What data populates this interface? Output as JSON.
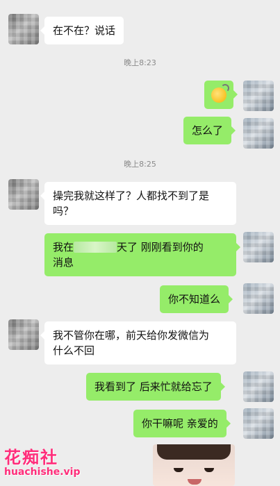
{
  "chat": {
    "messages": [
      {
        "side": "left",
        "text": "在不在？说话"
      },
      {
        "side": "time",
        "text": "晚上8:23"
      },
      {
        "side": "right",
        "icon": "confused-face-emoji-icon"
      },
      {
        "side": "right",
        "text": "怎么了"
      },
      {
        "side": "time",
        "text": "晚上8:25"
      },
      {
        "side": "left",
        "text": "操完我就这样了？人都找不到了是\n吗？"
      },
      {
        "side": "right",
        "text_before": "我在",
        "text_after": "天了 刚刚看到你的\n消息"
      },
      {
        "side": "right",
        "text": "你不知道么"
      },
      {
        "side": "left",
        "text": "我不管你在哪，前天给你发微信为\n什么不回"
      },
      {
        "side": "right",
        "text": "我看到了 后来忙就给忘了"
      },
      {
        "side": "right",
        "text": "你干嘛呢 亲爱的"
      }
    ]
  },
  "watermark": {
    "title": "花痴社",
    "url": "huachishe.vip"
  },
  "colors": {
    "background": "#ededed",
    "bubble_right": "#95ec69",
    "bubble_left": "#ffffff",
    "watermark": "#ff2d7a"
  }
}
